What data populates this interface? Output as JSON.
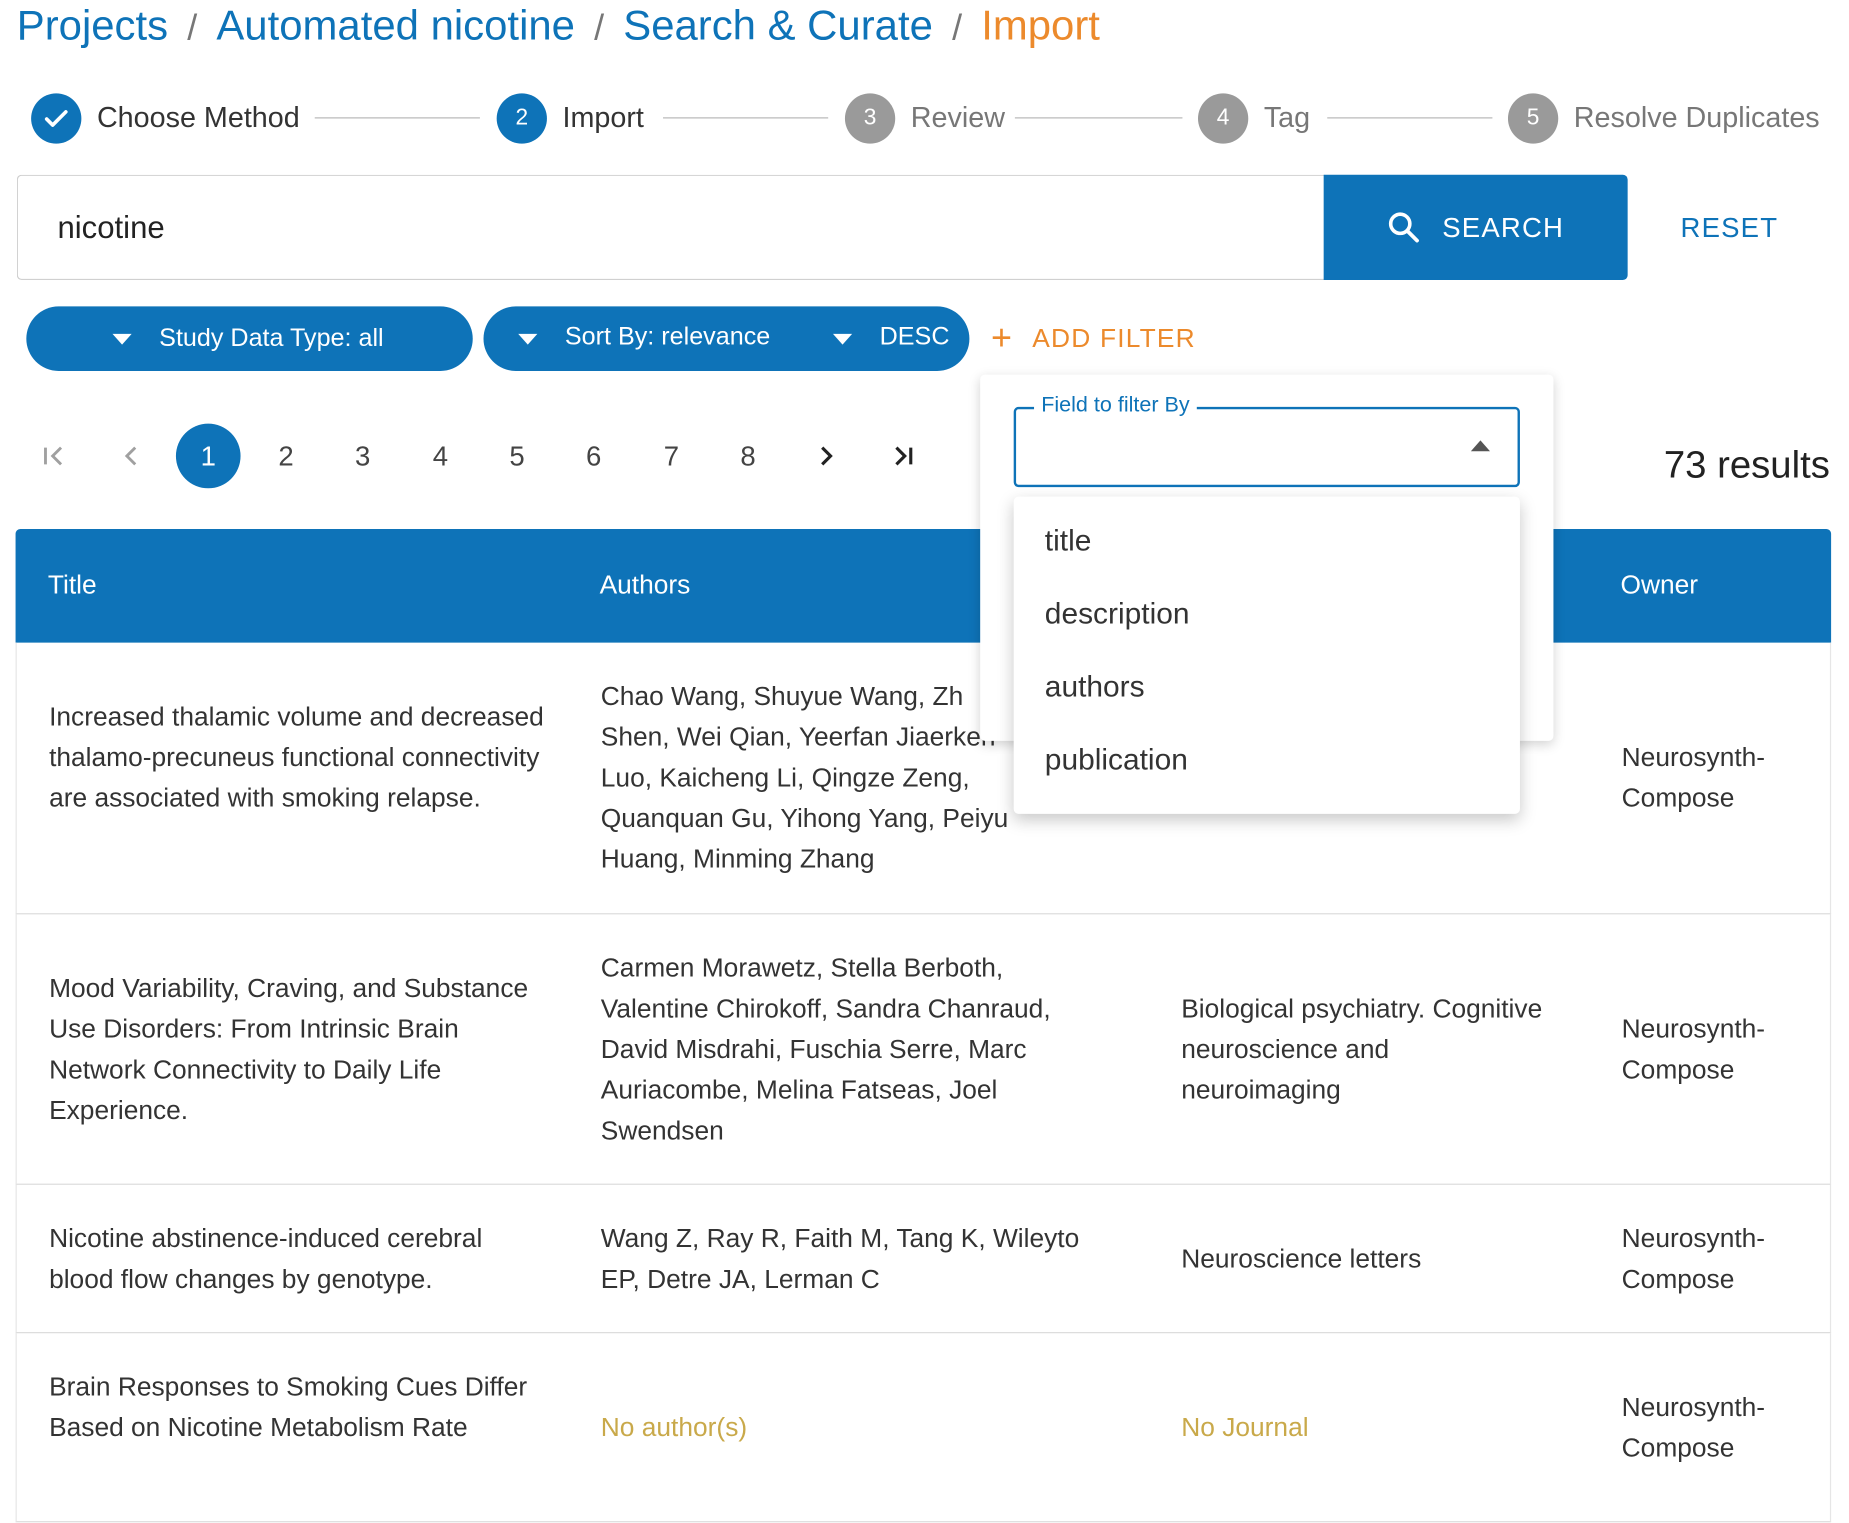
{
  "breadcrumb": {
    "items": [
      "Projects",
      "Automated nicotine",
      "Search & Curate"
    ],
    "current": "Import"
  },
  "stepper": {
    "steps": [
      {
        "num": "",
        "label": "Choose Method",
        "state": "done"
      },
      {
        "num": "2",
        "label": "Import",
        "state": "active"
      },
      {
        "num": "3",
        "label": "Review",
        "state": "todo"
      },
      {
        "num": "4",
        "label": "Tag",
        "state": "todo"
      },
      {
        "num": "5",
        "label": "Resolve Duplicates",
        "state": "todo"
      }
    ]
  },
  "search": {
    "value": "nicotine",
    "button_label": "SEARCH",
    "button_icon": "search-icon",
    "reset_label": "RESET"
  },
  "filters": {
    "study_data_type": "Study Data Type: all",
    "sort_by": "Sort By: relevance",
    "sort_direction": "DESC",
    "add_filter_label": "ADD FILTER",
    "field_label": "Field to filter By",
    "field_options": [
      "title",
      "description",
      "authors",
      "publication"
    ]
  },
  "pagination": {
    "pages": [
      "1",
      "2",
      "3",
      "4",
      "5",
      "6",
      "7",
      "8"
    ],
    "current_page": "1"
  },
  "results_count": "73 results",
  "table": {
    "headers": {
      "title": "Title",
      "authors": "Authors",
      "owner": "Owner"
    },
    "rows": [
      {
        "title": "Increased thalamic volume and decreased thalamo-precuneus functional connectivity are associated with smoking relapse.",
        "authors": "Chao Wang, Shuyue Wang, Zh Shen, Wei Qian, Yeerfan Jiaerken Luo, Kaicheng Li, Qingze Zeng, Quanquan Gu, Yihong Yang, Peiyu Huang, Minming Zhang",
        "journal": "",
        "owner": "Neurosynth-Compose"
      },
      {
        "title": "Mood Variability, Craving, and Substance Use Disorders: From Intrinsic Brain Network Connectivity to Daily Life Experience.",
        "authors": "Carmen Morawetz, Stella Berboth, Valentine Chirokoff, Sandra Chanraud, David Misdrahi, Fuschia Serre, Marc Auriacombe, Melina Fatseas, Joel Swendsen",
        "journal": "Biological psychiatry. Cognitive neuroscience and neuroimaging",
        "owner": "Neurosynth-Compose"
      },
      {
        "title": "Nicotine abstinence-induced cerebral blood flow changes by genotype.",
        "authors": "Wang Z, Ray R, Faith M, Tang K, Wileyto EP, Detre JA, Lerman C",
        "journal": "Neuroscience letters",
        "owner": "Neurosynth-Compose"
      },
      {
        "title": "Brain Responses to Smoking Cues Differ Based on Nicotine Metabolism Rate",
        "authors": "No author(s)",
        "journal": "No Journal",
        "owner": "Neurosynth-Compose"
      }
    ]
  },
  "colors": {
    "primary": "#0e73b8",
    "accent": "#ec8a2c",
    "muted_text": "#c9a94a",
    "inactive_step": "#9a9a9a"
  }
}
